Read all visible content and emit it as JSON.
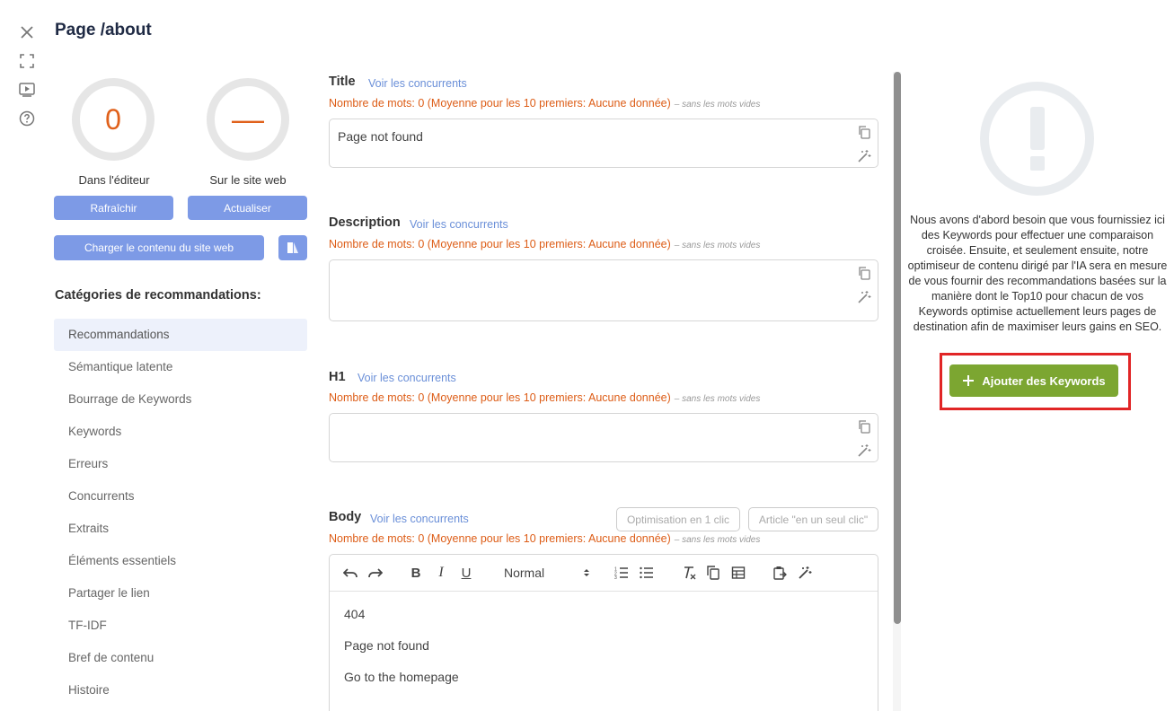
{
  "window": {
    "title": "Page /about"
  },
  "rail": {
    "icons": [
      "close-icon",
      "fullscreen-icon",
      "video-play-icon",
      "help-icon"
    ]
  },
  "scores": {
    "editor": {
      "value": "0",
      "label": "Dans l'éditeur"
    },
    "site": {
      "value": "—",
      "label": "Sur le site web"
    }
  },
  "buttons": {
    "refresh": "Rafraîchir",
    "update": "Actualiser",
    "load_content": "Charger le contenu du site web"
  },
  "categories": {
    "title": "Catégories de recommandations:",
    "items": [
      "Recommandations",
      "Sémantique latente",
      "Bourrage de Keywords",
      "Keywords",
      "Erreurs",
      "Concurrents",
      "Extraits",
      "Éléments essentiels",
      "Partager le lien",
      "TF-IDF",
      "Bref de contenu",
      "Histoire"
    ],
    "active_index": 0
  },
  "fields": {
    "title": {
      "label": "Title",
      "voir": "Voir les concurrents",
      "count": "Nombre de mots: 0 (Moyenne pour les 10 premiers: Aucune donnée)",
      "sans": "– sans les mots vides",
      "value": "Page not found"
    },
    "description": {
      "label": "Description",
      "voir": "Voir les concurrents",
      "count": "Nombre de mots: 0 (Moyenne pour les 10 premiers: Aucune donnée)",
      "sans": "– sans les mots vides",
      "value": ""
    },
    "h1": {
      "label": "H1",
      "voir": "Voir les concurrents",
      "count": "Nombre de mots: 0 (Moyenne pour les 10 premiers: Aucune donnée)",
      "sans": "– sans les mots vides",
      "value": ""
    },
    "body": {
      "label": "Body",
      "voir": "Voir les concurrents",
      "count": "Nombre de mots: 0 (Moyenne pour les 10 premiers: Aucune donnée)",
      "sans": "– sans les mots vides",
      "optimise_btn": "Optimisation en 1 clic",
      "article_btn": "Article \"en un seul clic\"",
      "format_select": "Normal",
      "content": [
        "404",
        "Page not found",
        "Go to the homepage"
      ]
    }
  },
  "right_panel": {
    "message": "Nous avons d'abord besoin que vous fournissiez ici des Keywords pour effectuer une comparaison croisée. Ensuite, et seulement ensuite, notre optimiseur de contenu dirigé par l'IA sera en mesure de vous fournir des recommandations basées sur la manière dont le Top10 pour chacun de vos Keywords optimise actuellement leurs pages de destination afin de maximiser leurs gains en SEO.",
    "add_button": "Ajouter des Keywords"
  },
  "colors": {
    "accent_blue": "#7d9ae6",
    "link_blue": "#6a8fd8",
    "orange": "#dd5d17",
    "green": "#7ca631",
    "highlight_red": "#e12526"
  }
}
